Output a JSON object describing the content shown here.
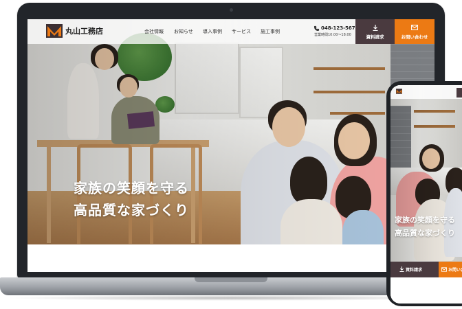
{
  "site": {
    "logo_text": "丸山工務店",
    "nav": [
      "会社情報",
      "お知らせ",
      "導入事例",
      "サービス",
      "施工事例"
    ],
    "phone_number": "048-123-5678",
    "business_hours": "営業時間10:00〜18:00",
    "document_request_label": "資料請求",
    "contact_label": "お問い合わせ"
  },
  "hero": {
    "catch_line1": "家族の笑顔を守る",
    "catch_line2": "高品質な家づくり"
  },
  "mobile": {
    "catch_line1": "家族の笑顔を守る",
    "catch_line2": "高品質な家づくり",
    "document_request_label": "資料請求",
    "contact_label": "お問い合わせ"
  },
  "colors": {
    "accent_orange": "#ec7a14",
    "dark_brown": "#4a3a3f",
    "device_frame": "#22252a"
  },
  "icons": [
    "phone-icon",
    "download-icon",
    "mail-icon",
    "logo-mark"
  ]
}
